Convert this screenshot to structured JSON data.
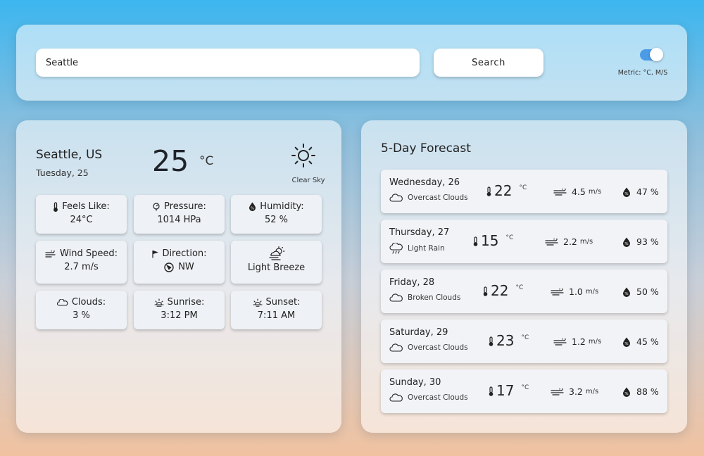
{
  "search": {
    "value": "Seattle",
    "button_label": "Search"
  },
  "units": {
    "label": "Metric: °C, M/S"
  },
  "current": {
    "city": "Seattle, US",
    "date": "Tuesday, 25",
    "temp": "25",
    "temp_unit": "°C",
    "condition": "Clear Sky",
    "icon": "sun-icon",
    "details": {
      "feels_like": {
        "label": "Feels Like:",
        "value": "24°C"
      },
      "pressure": {
        "label": "Pressure:",
        "value": "1014 HPa"
      },
      "humidity": {
        "label": "Humidity:",
        "value": "52 %"
      },
      "wind_speed": {
        "label": "Wind Speed:",
        "value": "2.7 m/s"
      },
      "direction": {
        "label": "Direction:",
        "value": "NW"
      },
      "breeze": {
        "label": "Light Breeze"
      },
      "clouds": {
        "label": "Clouds:",
        "value": "3 %"
      },
      "sunrise": {
        "label": "Sunrise:",
        "value": "3:12 PM"
      },
      "sunset": {
        "label": "Sunset:",
        "value": "7:11 AM"
      }
    }
  },
  "forecast": {
    "title": "5-Day Forecast",
    "days": [
      {
        "day": "Wednesday, 26",
        "desc": "Overcast Clouds",
        "icon": "cloud-icon",
        "temp": "22",
        "temp_unit": "°C",
        "wind": "4.5",
        "wind_unit": "m/s",
        "humidity": "47 %"
      },
      {
        "day": "Thursday, 27",
        "desc": "Light Rain",
        "icon": "rain-icon",
        "temp": "15",
        "temp_unit": "°C",
        "wind": "2.2",
        "wind_unit": "m/s",
        "humidity": "93 %"
      },
      {
        "day": "Friday, 28",
        "desc": "Broken Clouds",
        "icon": "cloud-icon",
        "temp": "22",
        "temp_unit": "°C",
        "wind": "1.0",
        "wind_unit": "m/s",
        "humidity": "50 %"
      },
      {
        "day": "Saturday, 29",
        "desc": "Overcast Clouds",
        "icon": "cloud-icon",
        "temp": "23",
        "temp_unit": "°C",
        "wind": "1.2",
        "wind_unit": "m/s",
        "humidity": "45 %"
      },
      {
        "day": "Sunday, 30",
        "desc": "Overcast Clouds",
        "icon": "cloud-icon",
        "temp": "17",
        "temp_unit": "°C",
        "wind": "3.2",
        "wind_unit": "m/s",
        "humidity": "88 %"
      }
    ]
  },
  "colors": {
    "toggle_accent": "#4c9be6"
  }
}
